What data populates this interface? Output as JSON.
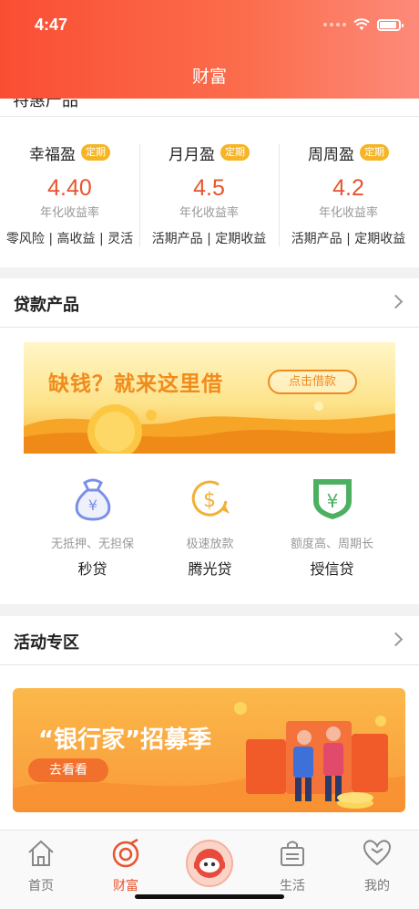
{
  "status_bar": {
    "time": "4:47"
  },
  "header": {
    "title": "财富"
  },
  "peek_section": {
    "title_partial": "特惠产品"
  },
  "wealth_products": [
    {
      "name": "幸福盈",
      "tag": "定期",
      "rate": "4.40",
      "rate_label": "年化收益率",
      "desc": "零风险 | 高收益 | 灵活"
    },
    {
      "name": "月月盈",
      "tag": "定期",
      "rate": "4.5",
      "rate_label": "年化收益率",
      "desc": "活期产品 | 定期收益"
    },
    {
      "name": "周周盈",
      "tag": "定期",
      "rate": "4.2",
      "rate_label": "年化收益率",
      "desc": "活期产品 | 定期收益"
    }
  ],
  "loan_section": {
    "title": "贷款产品",
    "banner": {
      "text": "缺钱？就来这里借",
      "button": "点击借款"
    },
    "items": [
      {
        "sub": "无抵押、无担保",
        "name": "秒贷",
        "icon": "money-bag-icon",
        "color": "#7b8fe6"
      },
      {
        "sub": "极速放款",
        "name": "腾光贷",
        "icon": "dollar-coin-icon",
        "color": "#f2b035"
      },
      {
        "sub": "额度高、周期长",
        "name": "授信贷",
        "icon": "yuan-shield-icon",
        "color": "#4caf62"
      }
    ]
  },
  "activity_section": {
    "title": "活动专区",
    "banner": {
      "text": "“银行家”招募季",
      "button": "去看看"
    }
  },
  "tabbar": [
    {
      "label": "首页",
      "icon": "home-icon",
      "active": false
    },
    {
      "label": "财富",
      "icon": "wealth-icon",
      "active": true
    },
    {
      "label": "",
      "icon": "robot-assistant-icon",
      "active": false
    },
    {
      "label": "生活",
      "icon": "shopping-bag-icon",
      "active": false
    },
    {
      "label": "我的",
      "icon": "heart-icon",
      "active": false
    }
  ],
  "colors": {
    "accent": "#e8542f",
    "header_start": "#fa4e33",
    "header_end": "#fd8a7a",
    "tag": "#f5b526"
  }
}
